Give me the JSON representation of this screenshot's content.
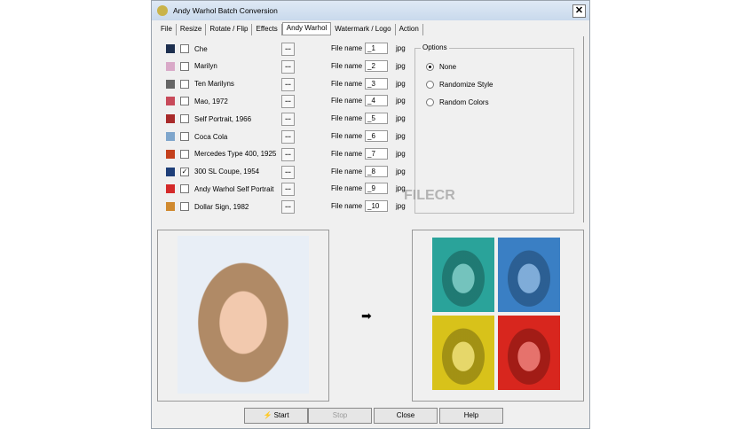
{
  "window": {
    "title": "Andy Warhol Batch Conversion",
    "close": "✕"
  },
  "tabs": [
    "File",
    "Resize",
    "Rotate / Flip",
    "Effects",
    "Andy Warhol",
    "Watermark / Logo",
    "Action"
  ],
  "active_tab": "Andy Warhol",
  "styles": [
    {
      "label": "Che",
      "checked": false,
      "file": "_1",
      "color": "#1d2f4f"
    },
    {
      "label": "Marilyn",
      "checked": false,
      "file": "_2",
      "color": "#d9a9c8"
    },
    {
      "label": "Ten Marilyns",
      "checked": false,
      "file": "_3",
      "color": "#666"
    },
    {
      "label": "Mao, 1972",
      "checked": false,
      "file": "_4",
      "color": "#c84a5a"
    },
    {
      "label": "Self Portrait, 1966",
      "checked": false,
      "file": "_5",
      "color": "#a82a2a"
    },
    {
      "label": "Coca Cola",
      "checked": false,
      "file": "_6",
      "color": "#7fa6cc"
    },
    {
      "label": "Mercedes Type 400, 1925",
      "checked": false,
      "file": "_7",
      "color": "#c4401c"
    },
    {
      "label": "300 SL Coupe, 1954",
      "checked": true,
      "file": "_8",
      "color": "#1e3e78"
    },
    {
      "label": "Andy Warhol Self Portrait",
      "checked": false,
      "file": "_9",
      "color": "#d42a2a"
    },
    {
      "label": "Dollar Sign, 1982",
      "checked": false,
      "file": "_10",
      "color": "#d08a30"
    }
  ],
  "browse_label": "...",
  "file_name_label": "File name",
  "ext": "jpg",
  "options": {
    "legend": "Options",
    "items": [
      {
        "label": "None",
        "selected": true
      },
      {
        "label": "Randomize Style",
        "selected": false
      },
      {
        "label": "Random Colors",
        "selected": false
      }
    ]
  },
  "quad_colors": [
    "#2aa39a",
    "#3a7fc4",
    "#d8c21a",
    "#d8261e"
  ],
  "arrow": "➡",
  "buttons": {
    "start": "Start",
    "stop": "Stop",
    "close": "Close",
    "help": "Help"
  },
  "watermark": "FILECR"
}
